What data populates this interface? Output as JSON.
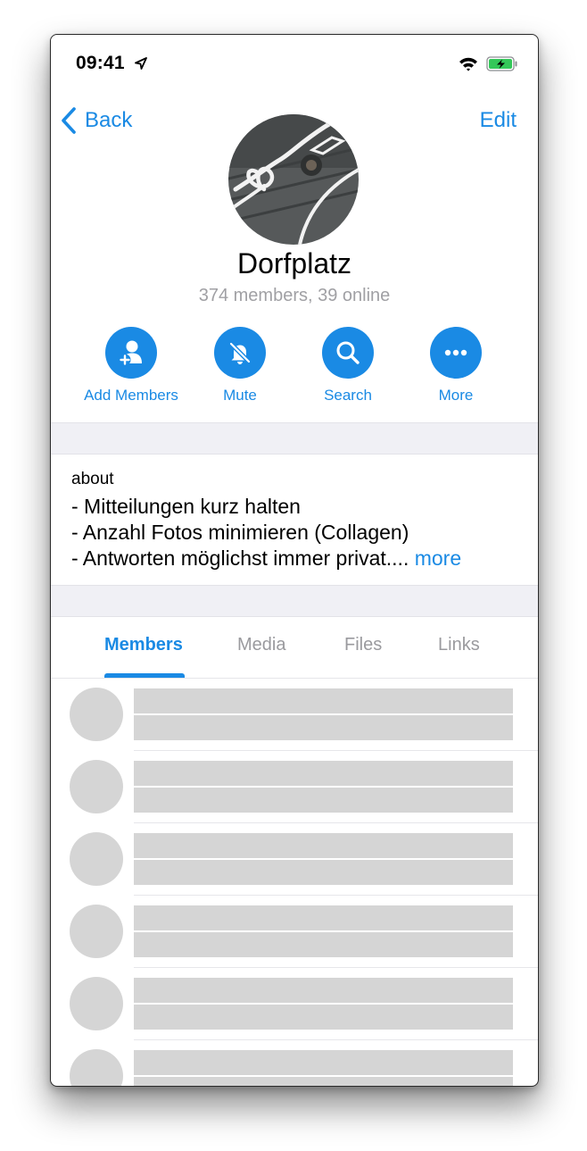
{
  "status_bar": {
    "time": "09:41",
    "icons": [
      "location-arrow-icon",
      "wifi-icon",
      "battery-charging-icon"
    ],
    "battery_color": "#34c759"
  },
  "header": {
    "back_label": "Back",
    "edit_label": "Edit"
  },
  "group": {
    "name": "Dorfplatz",
    "subtitle": "374 members, 39 online"
  },
  "actions": [
    {
      "label": "Add Members",
      "icon": "add-member-icon"
    },
    {
      "label": "Mute",
      "icon": "bell-slash-icon"
    },
    {
      "label": "Search",
      "icon": "search-icon"
    },
    {
      "label": "More",
      "icon": "ellipsis-icon"
    }
  ],
  "about": {
    "label": "about",
    "lines": [
      "- Mitteilungen kurz halten",
      "- Anzahl Fotos minimieren (Collagen)",
      "- Antworten möglichst immer privat...."
    ],
    "more_label": "more"
  },
  "tabs": [
    {
      "label": "Members",
      "active": true
    },
    {
      "label": "Media",
      "active": false
    },
    {
      "label": "Files",
      "active": false
    },
    {
      "label": "Links",
      "active": false
    }
  ],
  "colors": {
    "accent": "#1a8ae4",
    "secondary_text": "#a0a0a4",
    "placeholder": "#d5d5d5",
    "section_gap": "#f0f0f5"
  },
  "member_placeholders_count": 6
}
